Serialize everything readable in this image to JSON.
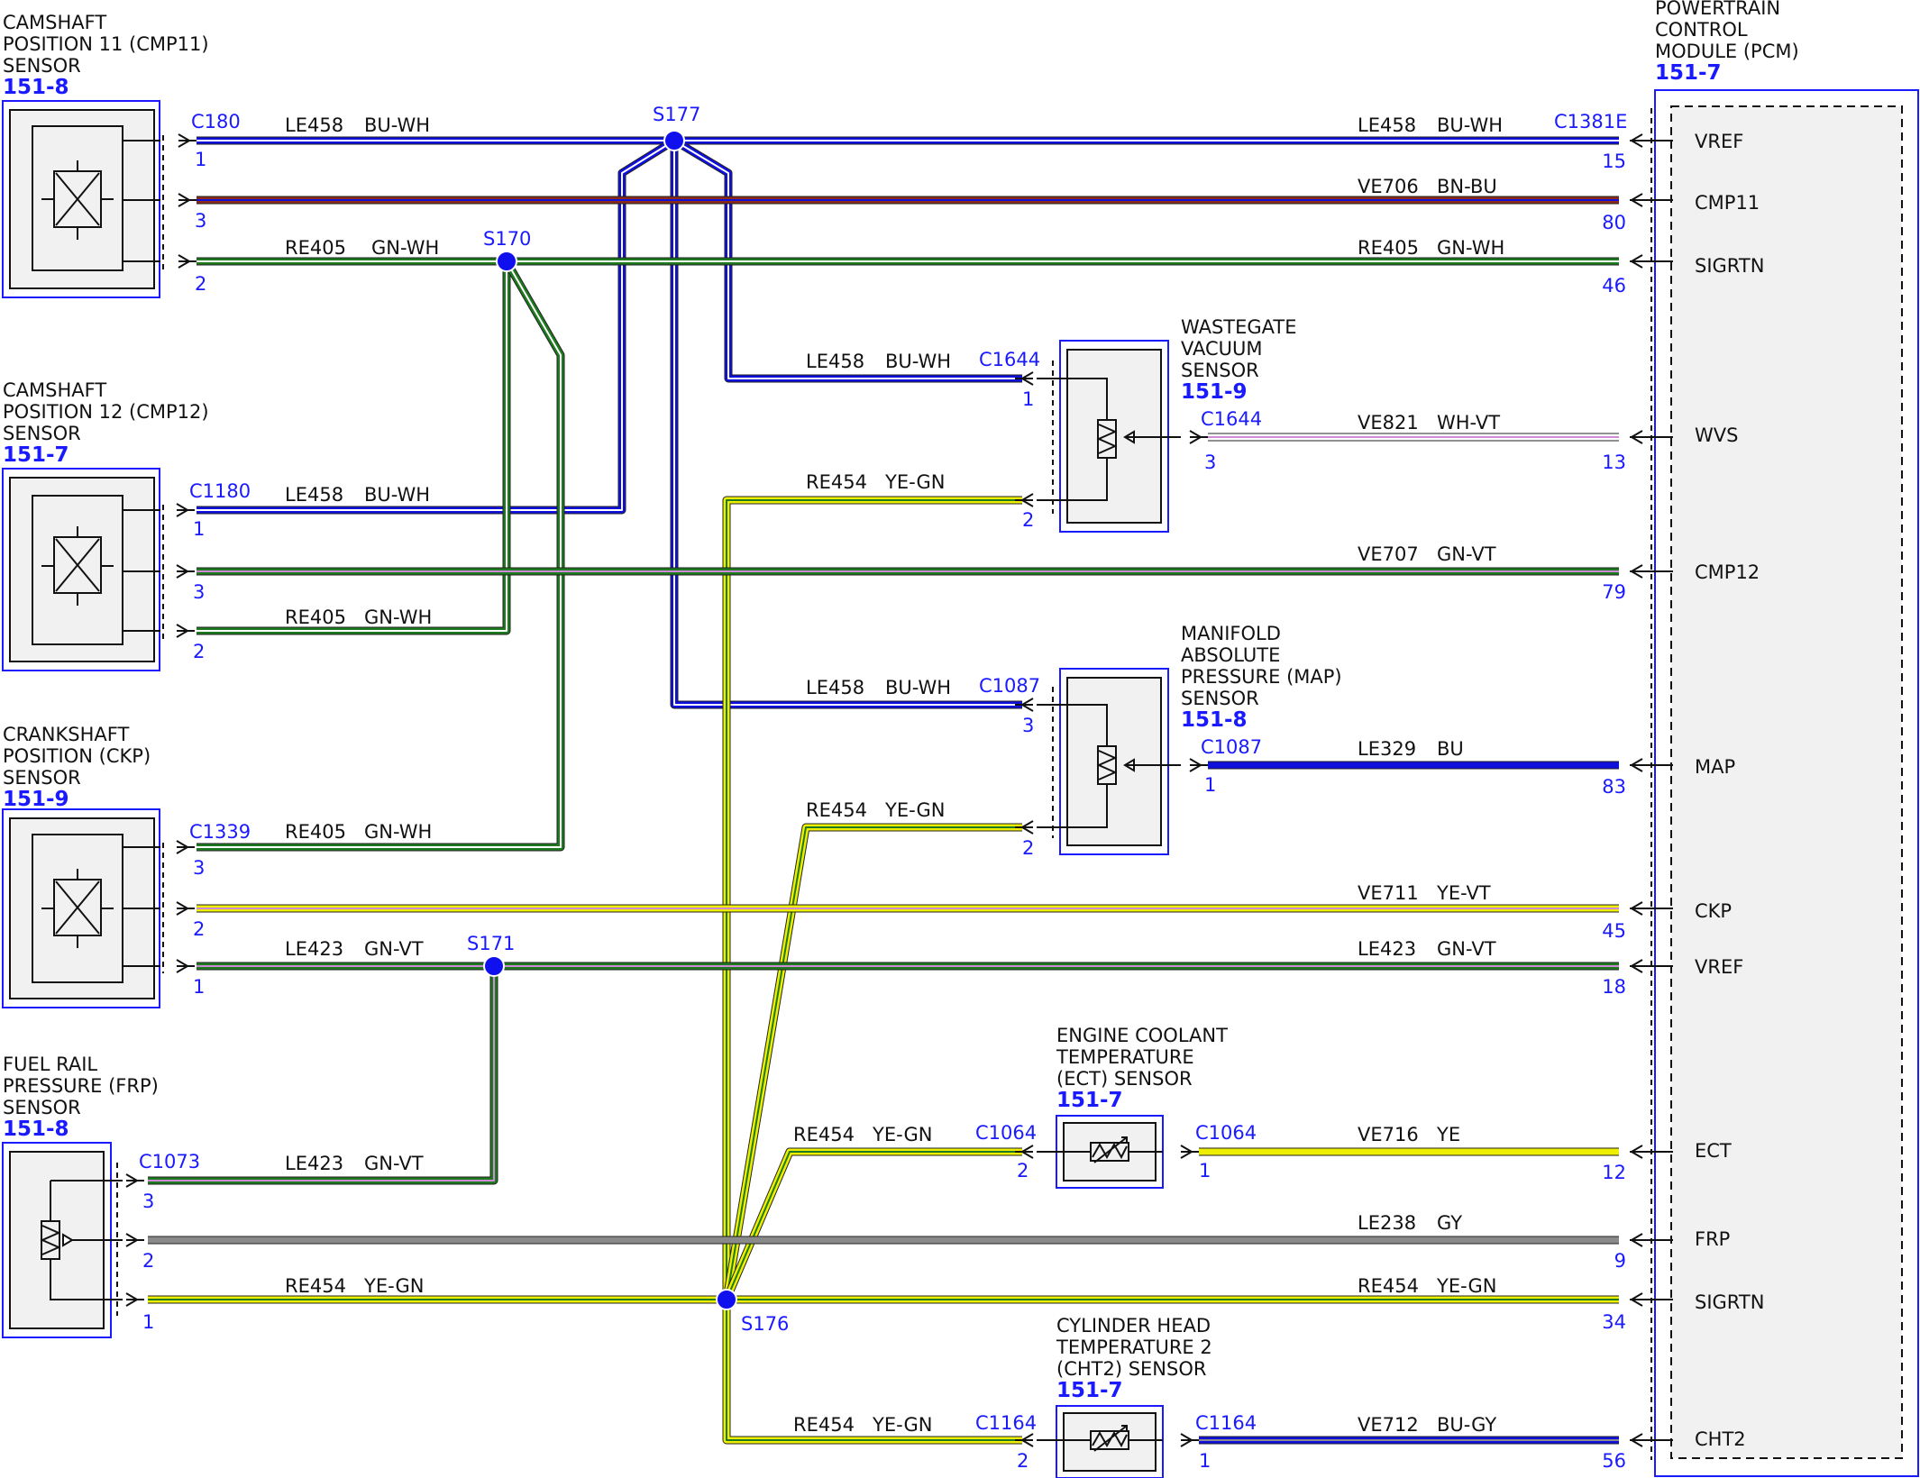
{
  "colors": {
    "BU": "#1010dd",
    "WH": "#ffffff",
    "GN": "#1e7a1e",
    "YE": "#eeee00",
    "BN": "#8b2a1a",
    "VT": "#d08ad8",
    "GY": "#8a8a8a",
    "splice": "#1010ee",
    "module_border": "#1a1aff",
    "module_fill": "#f1f1f1"
  },
  "components": [
    {
      "id": "cmp11",
      "lines": [
        "CAMSHAFT",
        "POSITION 11 (CMP11)",
        "SENSOR"
      ],
      "page": "151-8"
    },
    {
      "id": "cmp12",
      "lines": [
        "CAMSHAFT",
        "POSITION 12 (CMP12)",
        "SENSOR"
      ],
      "page": "151-7"
    },
    {
      "id": "ckp",
      "lines": [
        "CRANKSHAFT",
        "POSITION (CKP)",
        "SENSOR"
      ],
      "page": "151-9"
    },
    {
      "id": "frp",
      "lines": [
        "FUEL RAIL",
        "PRESSURE (FRP)",
        "SENSOR"
      ],
      "page": "151-8"
    },
    {
      "id": "wvs",
      "lines": [
        "WASTEGATE",
        "VACUUM",
        "SENSOR"
      ],
      "page": "151-9"
    },
    {
      "id": "map",
      "lines": [
        "MANIFOLD",
        "ABSOLUTE",
        "PRESSURE (MAP)",
        "SENSOR"
      ],
      "page": "151-8"
    },
    {
      "id": "ect",
      "lines": [
        "ENGINE COOLANT",
        "TEMPERATURE",
        "(ECT) SENSOR"
      ],
      "page": "151-7"
    },
    {
      "id": "cht2",
      "lines": [
        "CYLINDER HEAD",
        "TEMPERATURE 2",
        "(CHT2) SENSOR"
      ],
      "page": "151-7"
    },
    {
      "id": "pcm",
      "lines": [
        "POWERTRAIN",
        "CONTROL",
        "MODULE (PCM)"
      ],
      "page": "151-7"
    }
  ],
  "connectors": {
    "c180": "C180",
    "c1180": "C1180",
    "c1339": "C1339",
    "c1073": "C1073",
    "c1381e": "C1381E",
    "c1644a": "C1644",
    "c1644b": "C1644",
    "c1087a": "C1087",
    "c1087b": "C1087",
    "c1064a": "C1064",
    "c1064b": "C1064",
    "c1164a": "C1164",
    "c1164b": "C1164"
  },
  "splices": {
    "s177": "S177",
    "s170": "S170",
    "s171": "S171",
    "s176": "S176"
  },
  "pcm_signals": [
    "VREF",
    "CMP11",
    "SIGRTN",
    "WVS",
    "CMP12",
    "MAP",
    "CKP",
    "VREF",
    "ECT",
    "FRP",
    "SIGRTN",
    "CHT2"
  ],
  "pcm_pins": [
    "15",
    "80",
    "46",
    "13",
    "79",
    "83",
    "45",
    "18",
    "12",
    "9",
    "34",
    "56"
  ],
  "circuits": {
    "le458": "LE458",
    "bu_wh": "BU-WH",
    "ve706": "VE706",
    "bn_bu": "BN-BU",
    "re405": "RE405",
    "gn_wh": "GN-WH",
    "ve821": "VE821",
    "wh_vt": "WH-VT",
    "re454": "RE454",
    "ye_gn": "YE-GN",
    "ve707": "VE707",
    "gn_vt": "GN-VT",
    "le329": "LE329",
    "bu": "BU",
    "ve711": "VE711",
    "ye_vt": "YE-VT",
    "le423": "LE423",
    "ve716": "VE716",
    "ye": "YE",
    "le238": "LE238",
    "gy": "GY",
    "ve712": "VE712",
    "bu_gy": "BU-GY"
  },
  "sensor_pins": {
    "cmp11": [
      "1",
      "3",
      "2"
    ],
    "cmp12": [
      "1",
      "3",
      "2"
    ],
    "ckp": [
      "3",
      "2",
      "1"
    ],
    "frp": [
      "3",
      "2",
      "1"
    ],
    "wvs": [
      "1",
      "3",
      "2"
    ],
    "map": [
      "3",
      "1",
      "2"
    ],
    "ect": [
      "2",
      "1"
    ],
    "cht2": [
      "2",
      "1"
    ]
  }
}
